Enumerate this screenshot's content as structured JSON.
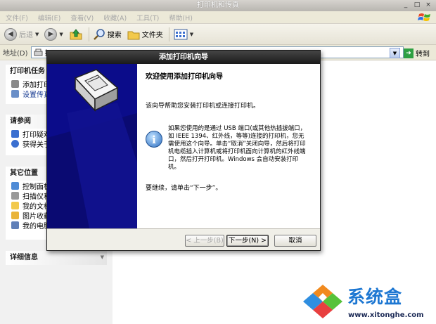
{
  "window": {
    "title": "打印机和传真",
    "controls": [
      "_",
      "□",
      "×"
    ]
  },
  "menubar": {
    "items": [
      "文件(F)",
      "编辑(E)",
      "查看(V)",
      "收藏(A)",
      "工具(T)",
      "帮助(H)"
    ]
  },
  "toolbar": {
    "back_label": "后退",
    "search_label": "搜索",
    "folders_label": "文件夹"
  },
  "addressbar": {
    "label": "地址(D)",
    "value": "打",
    "go_label": "转到"
  },
  "taskpane": {
    "printer_tasks": {
      "title": "打印机任务",
      "items": [
        "添加打印",
        "设置传真"
      ]
    },
    "see_also": {
      "title": "请参阅",
      "items": [
        "打印疑难",
        "获得关于"
      ]
    },
    "other_places": {
      "title": "其它位置",
      "items": [
        "控制面板",
        "扫描仪和",
        "我的文档",
        "图片收藏",
        "我的电脑"
      ]
    },
    "details": {
      "title": "详细信息"
    }
  },
  "wizard": {
    "title": "添加打印机向导",
    "heading": "欢迎使用添加打印机向导",
    "intro": "该向导帮助您安装打印机或连接打印机。",
    "info": "如果您使用的是通过 USB 端口(或其他热插拔端口，如 IEEE 1394、红外线，等等)连接的打印机，您无需使用这个向导。单击“取消”关闭向导，然后将打印机电缆插入计算机或将打印机面向计算机的红外线端口，然后打开打印机。Windows 会自动安装打印机。",
    "continue": "要继续，请单击“下一步”。",
    "buttons": {
      "back": "< 上一步(B)",
      "next": "下一步(N) >",
      "cancel": "取消"
    }
  },
  "watermark": {
    "name": "系统盒",
    "url": "www.xitonghe.com"
  },
  "colors": {
    "wizard_side": "#0b0c8a",
    "watermark_blue": "#1d77d2"
  }
}
